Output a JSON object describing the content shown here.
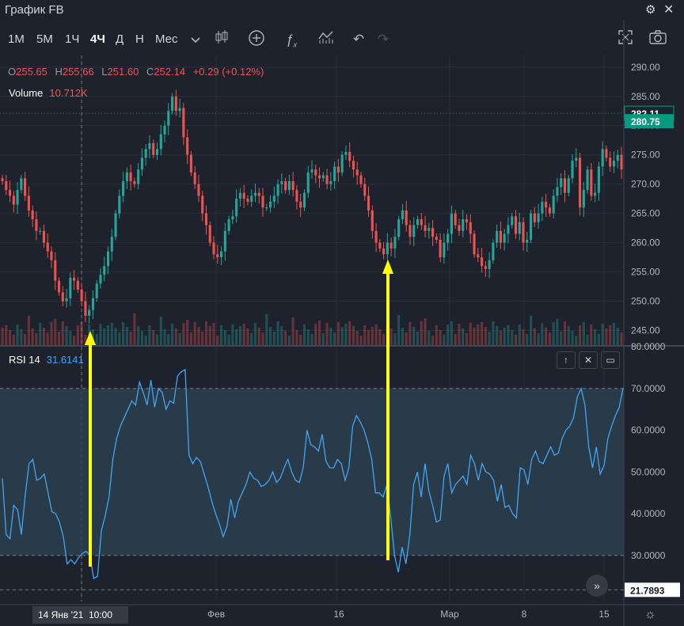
{
  "window": {
    "title": "График FB"
  },
  "toolbar": {
    "timeframes": [
      "1М",
      "5М",
      "1Ч",
      "4Ч",
      "Д",
      "Н",
      "Мес"
    ],
    "active_timeframe": "4Ч",
    "icons": [
      "chevron-down-icon",
      "candles-icon",
      "add-indicator-icon",
      "fx-icon",
      "compare-icon",
      "undo-icon",
      "redo-icon",
      "fullscreen-icon",
      "camera-icon"
    ]
  },
  "legend": {
    "o_label": "O",
    "o": "255.65",
    "h_label": "H",
    "h": "255.66",
    "l_label": "L",
    "l": "251.60",
    "c_label": "C",
    "c": "252.14",
    "change": "+0.29 (+0.12%)",
    "volume_label": "Volume",
    "volume": "10.712K"
  },
  "rsi": {
    "label": "RSI 14",
    "value": "31.6141"
  },
  "colors": {
    "bg": "#1e222d",
    "up": "#26a69a",
    "down": "#ef5350",
    "rsi": "#42a5f5",
    "arrow": "#ffff00",
    "tag": "#089981"
  },
  "chart_data": {
    "type": "candlestick",
    "symbol": "FB",
    "price_axis": {
      "ticks": [
        290,
        285,
        280,
        275,
        270,
        265,
        260,
        255,
        250,
        245
      ],
      "labels": [
        "290.00",
        "285.00",
        "280.00",
        "275.00",
        "270.00",
        "265.00",
        "260.00",
        "255.00",
        "250.00",
        "245.00"
      ],
      "ylim": [
        242.5,
        292
      ]
    },
    "price_tags": [
      {
        "value": "282.11",
        "style": "outline"
      },
      {
        "value": "280.75",
        "style": "filled"
      }
    ],
    "rsi_axis": {
      "ticks": [
        80,
        70,
        60,
        50,
        40,
        30
      ],
      "labels": [
        "80.0000",
        "70.0000",
        "60.0000",
        "50.0000",
        "40.0000",
        "30.0000"
      ],
      "ylim": [
        19,
        80
      ],
      "band": [
        30,
        70
      ],
      "current_tag": "21.7893"
    },
    "x_labels": [
      "Фев",
      "16",
      "Мар",
      "8",
      "15"
    ],
    "crosshair_label": "14 Янв '21  10:00",
    "close": [
      270.5,
      269,
      268,
      266.5,
      269,
      271,
      268,
      265.5,
      264,
      262,
      262,
      260,
      258.5,
      257,
      253.5,
      251.5,
      250,
      250.5,
      254,
      253.5,
      252,
      250,
      247.5,
      248.5,
      250.5,
      253,
      254.5,
      256,
      258.5,
      261,
      265,
      268,
      270.5,
      272,
      270.5,
      270,
      272.5,
      274.5,
      276,
      277,
      275,
      276,
      278.5,
      280,
      282.5,
      285,
      282.5,
      283,
      278,
      275,
      272,
      270,
      268,
      265,
      263,
      260,
      258,
      257.5,
      258.5,
      262,
      264,
      264.5,
      267.5,
      268.5,
      267.5,
      267,
      268,
      268.5,
      268,
      266,
      266,
      267,
      268,
      270,
      270.5,
      269,
      270.5,
      269,
      267,
      266,
      268.5,
      272,
      272.5,
      271.5,
      271,
      271.5,
      270,
      270.5,
      273,
      272,
      275,
      275.5,
      274,
      272.5,
      271.5,
      270,
      268,
      265.5,
      262,
      260,
      259,
      258,
      260,
      259,
      261,
      264,
      265.5,
      263,
      261,
      263,
      264,
      263,
      262,
      262.5,
      261,
      260.5,
      257.5,
      260,
      261.5,
      265,
      263,
      262,
      264,
      263.5,
      261.5,
      258,
      257.5,
      256,
      255.5,
      257,
      260,
      262,
      260,
      261.5,
      263,
      264.5,
      261.5,
      263.5,
      260,
      260.5,
      265,
      263.5,
      265,
      267,
      266,
      265,
      268,
      269.5,
      271,
      268.5,
      271,
      274,
      274.5,
      266,
      269,
      272.5,
      268,
      268.5,
      273,
      276,
      274.5,
      273,
      274,
      275,
      272.5
    ],
    "rsi_values": [
      48.5,
      35,
      34,
      42,
      41,
      35,
      44.5,
      52,
      53,
      48,
      48.5,
      49.5,
      45,
      40.5,
      40,
      38,
      34.5,
      28,
      29,
      28,
      29.5,
      30.5,
      31,
      30,
      24.5,
      25,
      36,
      39.5,
      44,
      53,
      58,
      61,
      63,
      65,
      67,
      66,
      71.5,
      69,
      66,
      72,
      65.5,
      70,
      69,
      65,
      67,
      66.5,
      73,
      74,
      74.5,
      54,
      52,
      53.5,
      52.5,
      49.5,
      46.5,
      43,
      40,
      37.5,
      34.5,
      37,
      43.5,
      39,
      43,
      45,
      47,
      50,
      48.5,
      48,
      46.5,
      47,
      48,
      50,
      47.5,
      48.5,
      51,
      53,
      50,
      48,
      47.5,
      51,
      60,
      56.5,
      56,
      55,
      59,
      52.5,
      51,
      51,
      53,
      52,
      48,
      51,
      61,
      63.5,
      62,
      60,
      57,
      53,
      45,
      45,
      44,
      47,
      39,
      30,
      26,
      32,
      28,
      35,
      47,
      50,
      44,
      52,
      45.5,
      42,
      38,
      38.5,
      49,
      52,
      45,
      47,
      48,
      49,
      47,
      54,
      52,
      48,
      52,
      50,
      49.5,
      48,
      43,
      47,
      41.5,
      42,
      40,
      39,
      51,
      50.5,
      47,
      53,
      55,
      52.5,
      52,
      54,
      56,
      54,
      54.5,
      58,
      60,
      61,
      63,
      68,
      70,
      66,
      56,
      51,
      56,
      49.5,
      51.5,
      58,
      61,
      63.5,
      65.5,
      70
    ]
  }
}
